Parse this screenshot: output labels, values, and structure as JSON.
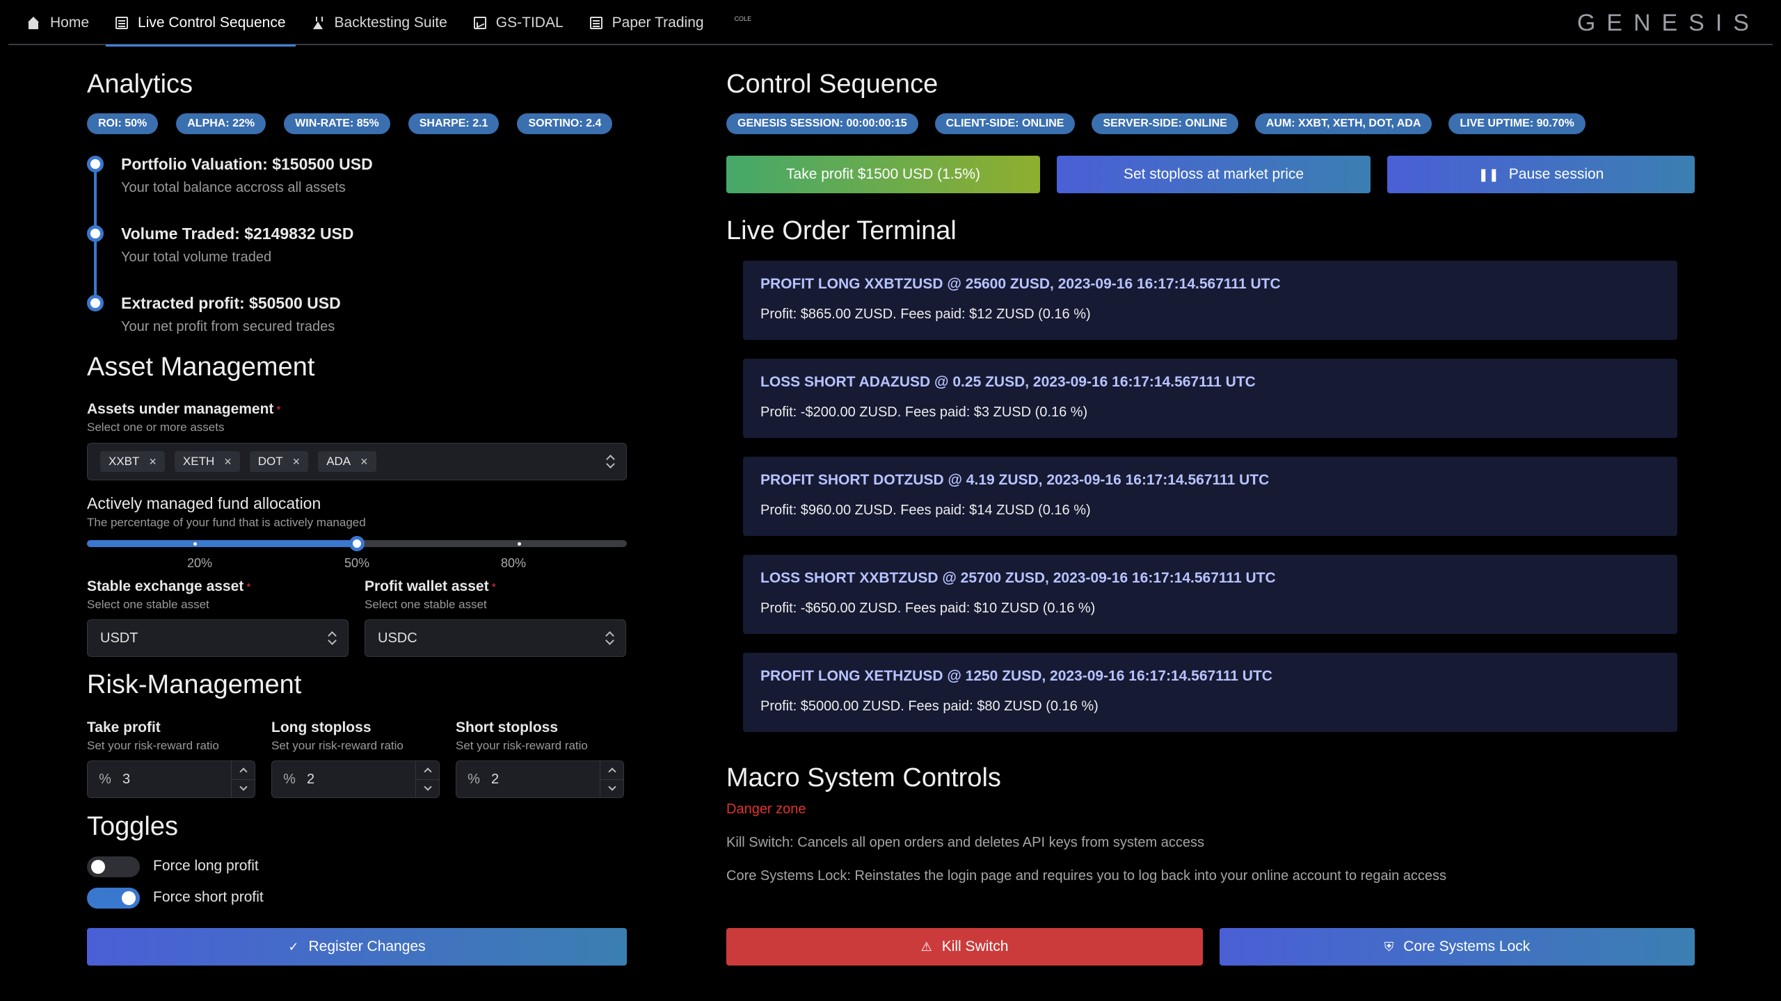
{
  "nav": {
    "tabs": [
      {
        "label": "Home",
        "icon": "home-icon"
      },
      {
        "label": "Live Control Sequence",
        "icon": "spreadsheet-icon",
        "active": true
      },
      {
        "label": "Backtesting Suite",
        "icon": "flask-icon"
      },
      {
        "label": "GS-TIDAL",
        "icon": "chart-icon"
      },
      {
        "label": "Paper Trading",
        "icon": "spreadsheet-icon"
      }
    ],
    "extra": "COLE",
    "brand": "GENESIS"
  },
  "analytics": {
    "title": "Analytics",
    "badges": [
      "ROI: 50%",
      "ALPHA: 22%",
      "WIN-RATE: 85%",
      "SHARPE: 2.1",
      "SORTINO: 2.4"
    ],
    "timeline": [
      {
        "title": "Portfolio Valuation: $150500 USD",
        "desc": "Your total balance accross all assets"
      },
      {
        "title": "Volume Traded: $2149832 USD",
        "desc": "Your total volume traded"
      },
      {
        "title": "Extracted profit: $50500 USD",
        "desc": "Your net profit from secured trades"
      }
    ]
  },
  "asset_mgmt": {
    "title": "Asset Management",
    "assets_label": "Assets under management",
    "assets_desc": "Select one or more assets",
    "assets": [
      "XXBT",
      "XETH",
      "DOT",
      "ADA"
    ],
    "alloc_label": "Actively managed fund allocation",
    "alloc_desc": "The percentage of your fund that is actively managed",
    "alloc_value": 0.5,
    "alloc_marks": [
      "20%",
      "50%",
      "80%"
    ],
    "stable_label": "Stable exchange asset",
    "stable_desc": "Select one stable asset",
    "stable_value": "USDT",
    "profit_label": "Profit wallet asset",
    "profit_desc": "Select one stable asset",
    "profit_value": "USDC"
  },
  "risk": {
    "title": "Risk-Management",
    "fields": [
      {
        "label": "Take profit",
        "desc": "Set your risk-reward ratio",
        "prefix": "%",
        "value": "3"
      },
      {
        "label": "Long stoploss",
        "desc": "Set your risk-reward ratio",
        "prefix": "%",
        "value": "2"
      },
      {
        "label": "Short stoploss",
        "desc": "Set your risk-reward ratio",
        "prefix": "%",
        "value": "2"
      }
    ]
  },
  "toggles": {
    "title": "Toggles",
    "items": [
      {
        "label": "Force long profit",
        "on": false
      },
      {
        "label": "Force short profit",
        "on": true
      }
    ]
  },
  "register_label": "Register Changes",
  "control": {
    "title": "Control Sequence",
    "badges": [
      "GENESIS SESSION: 00:00:00:15",
      "CLIENT-SIDE: ONLINE",
      "SERVER-SIDE: ONLINE",
      "AUM: XXBT, XETH, DOT, ADA",
      "LIVE UPTIME: 90.70%"
    ],
    "take_profit_label": "Take profit $1500 USD (1.5%)",
    "stoploss_label": "Set stoploss at market price",
    "pause_label": "Pause session"
  },
  "terminal": {
    "title": "Live Order Terminal",
    "orders": [
      {
        "title": "PROFIT LONG XXBTZUSD @ 25600 ZUSD, 2023-09-16 16:17:14.567111 UTC",
        "body": "Profit: $865.00 ZUSD. Fees paid: $12 ZUSD (0.16 %)"
      },
      {
        "title": "LOSS SHORT ADAZUSD @ 0.25 ZUSD, 2023-09-16 16:17:14.567111 UTC",
        "body": "Profit: -$200.00 ZUSD. Fees paid: $3 ZUSD (0.16 %)"
      },
      {
        "title": "PROFIT SHORT DOTZUSD @ 4.19 ZUSD, 2023-09-16 16:17:14.567111 UTC",
        "body": "Profit: $960.00 ZUSD. Fees paid: $14 ZUSD (0.16 %)"
      },
      {
        "title": "LOSS SHORT XXBTZUSD @ 25700 ZUSD, 2023-09-16 16:17:14.567111 UTC",
        "body": "Profit: -$650.00 ZUSD. Fees paid: $10 ZUSD (0.16 %)"
      },
      {
        "title": "PROFIT LONG XETHZUSD @ 1250 ZUSD, 2023-09-16 16:17:14.567111 UTC",
        "body": "Profit: $5000.00 ZUSD. Fees paid: $80 ZUSD (0.16 %)"
      }
    ]
  },
  "macro": {
    "title": "Macro System Controls",
    "danger": "Danger zone",
    "kill_desc": "Kill Switch: Cancels all open orders and deletes API keys from system access",
    "lock_desc": "Core Systems Lock: Reinstates the login page and requires you to log back into your online account to regain access",
    "kill_label": "Kill Switch",
    "lock_label": "Core Systems Lock"
  },
  "colors": {
    "background": "#000000",
    "accent": "#3a78d0",
    "badge": "#3a6fb0",
    "order_card": "#161a33",
    "danger": "#cc3b3b"
  }
}
